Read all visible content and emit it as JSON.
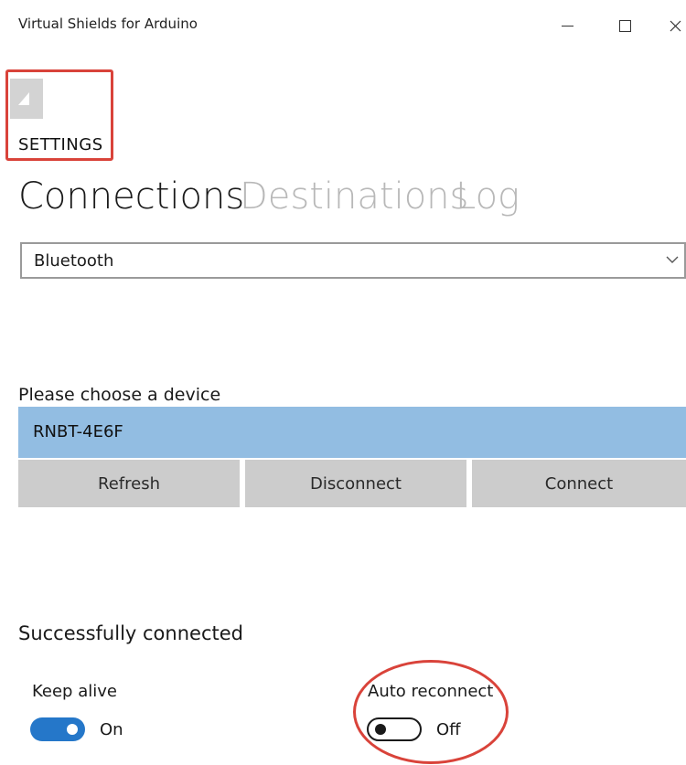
{
  "window": {
    "title": "Virtual Shields for Arduino",
    "controls": {
      "minimize_icon": "minimize-icon",
      "maximize_icon": "maximize-icon",
      "close_icon": "close-icon"
    }
  },
  "header": {
    "back_icon": "back-arrow-icon",
    "section_label": "SETTINGS"
  },
  "tabs": [
    {
      "label": "Connections",
      "active": true
    },
    {
      "label": "Destinations",
      "active": false
    },
    {
      "label": "Log",
      "active": false
    }
  ],
  "connection_type": {
    "selected": "Bluetooth",
    "icon": "chevron-down-icon"
  },
  "devices": {
    "prompt": "Please choose a device",
    "items": [
      {
        "name": "RNBT-4E6F",
        "selected": true
      }
    ]
  },
  "actions": {
    "refresh_label": "Refresh",
    "disconnect_label": "Disconnect",
    "connect_label": "Connect"
  },
  "status": {
    "message": "Successfully connected"
  },
  "toggles": {
    "keep_alive": {
      "label": "Keep alive",
      "state_label": "On",
      "on": true
    },
    "auto_reconnect": {
      "label": "Auto reconnect",
      "state_label": "Off",
      "on": false
    }
  },
  "colors": {
    "accent": "#2577c9",
    "selection": "#92bde2",
    "button_bg": "#cccccc",
    "annotation": "#d9433a",
    "inactive_tab": "#b8b8b8"
  }
}
